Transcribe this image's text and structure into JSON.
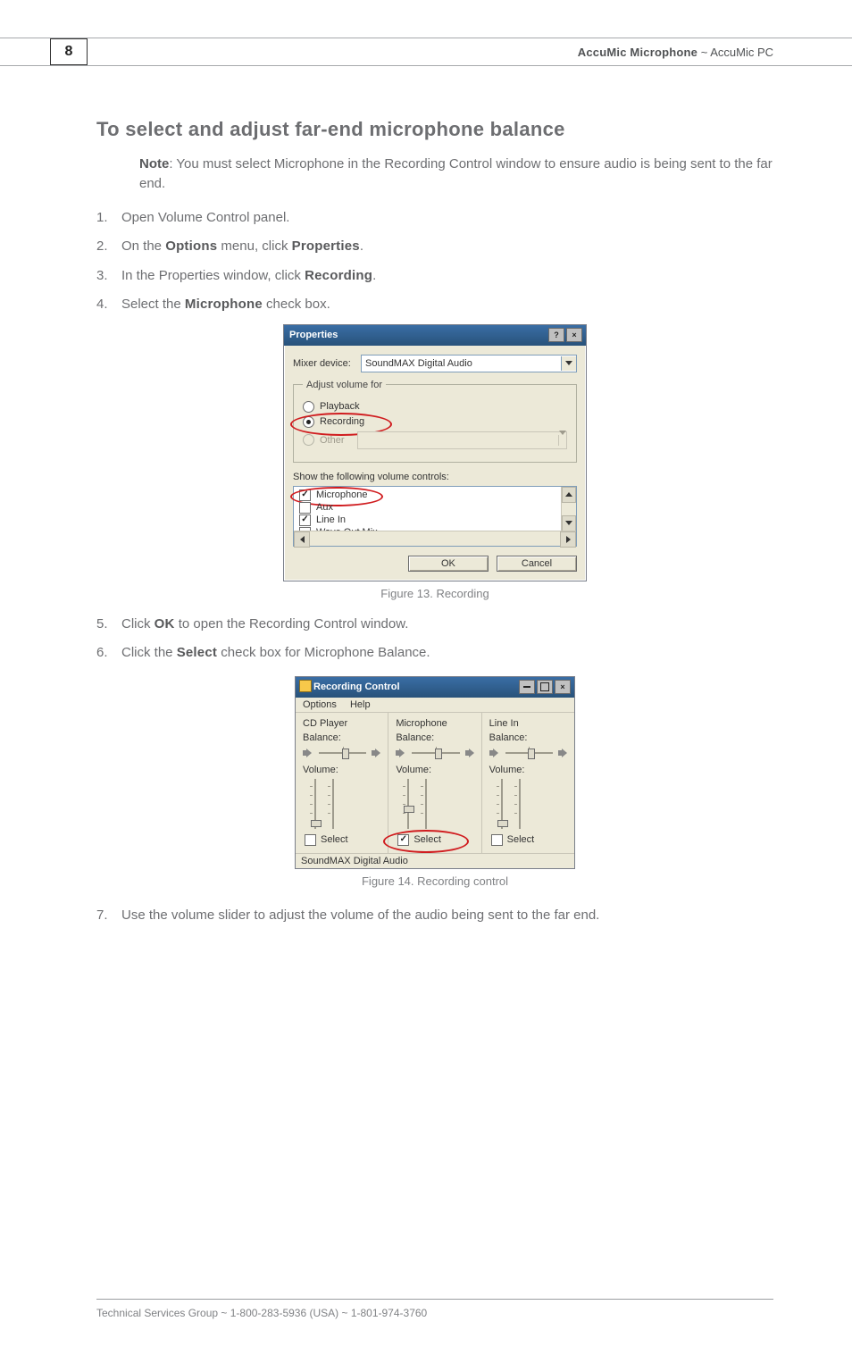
{
  "page_number": "8",
  "header": {
    "bold": "AccuMic Microphone",
    "light": " ~ AccuMic PC"
  },
  "section_title": "To select and adjust far-end microphone balance",
  "note": {
    "label": "Note",
    "text": ": You must select Microphone in the Recording Control window to ensure audio is being sent to the far end."
  },
  "steps_a": [
    {
      "pre": "Open Volume Control panel."
    },
    {
      "pre": "On the ",
      "b1": "Options",
      "mid": " menu, click ",
      "b2": "Properties",
      "post": "."
    },
    {
      "pre": "In the Properties window, click ",
      "b1": "Recording",
      "post": "."
    },
    {
      "pre": "Select the ",
      "b1": "Microphone",
      "post": " check box."
    }
  ],
  "fig13_caption": "Figure 13. Recording",
  "steps_b": [
    {
      "pre": "Click ",
      "b1": "OK",
      "post": " to open the Recording Control window."
    },
    {
      "pre": "Click the ",
      "b1": "Select",
      "post": " check box for Microphone Balance."
    }
  ],
  "fig14_caption": "Figure 14. Recording control",
  "steps_c": [
    {
      "pre": "Use the volume slider to adjust the volume of the audio being sent to the far end."
    }
  ],
  "footer": "Technical Services Group ~ 1-800-283-5936 (USA) ~ 1-801-974-3760",
  "properties_dialog": {
    "title": "Properties",
    "help_glyph": "?",
    "close_glyph": "×",
    "mixer_label": "Mixer device:",
    "mixer_value": "SoundMAX Digital Audio",
    "group_legend": "Adjust volume for",
    "radio_playback": "Playback",
    "radio_recording": "Recording",
    "radio_other": "Other",
    "list_label": "Show the following volume controls:",
    "items": {
      "microphone": "Microphone",
      "aux": "Aux",
      "linein": "Line In",
      "waveout": "Wave Out Mix"
    },
    "ok": "OK",
    "cancel": "Cancel"
  },
  "recording_control": {
    "title": "Recording Control",
    "menu_options": "Options",
    "menu_help": "Help",
    "min_glyph": "",
    "max_glyph": "",
    "close_glyph": "×",
    "cols": [
      {
        "name": "CD Player",
        "balance": "Balance:",
        "volume": "Volume:",
        "select": "Select",
        "checked": false
      },
      {
        "name": "Microphone",
        "balance": "Balance:",
        "volume": "Volume:",
        "select": "Select",
        "checked": true
      },
      {
        "name": "Line In",
        "balance": "Balance:",
        "volume": "Volume:",
        "select": "Select",
        "checked": false
      }
    ],
    "status": "SoundMAX Digital Audio"
  }
}
